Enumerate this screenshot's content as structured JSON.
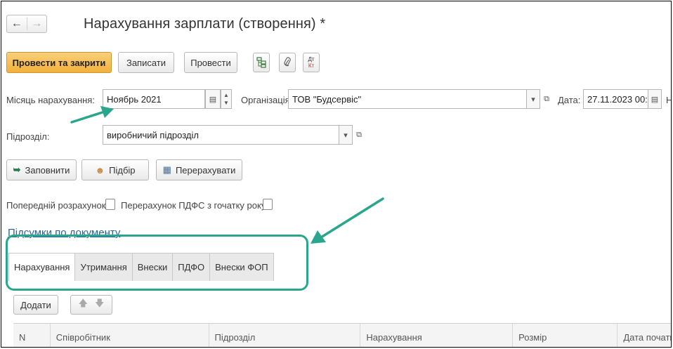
{
  "header": {
    "back_icon": "arrow-left-icon",
    "forward_icon": "arrow-right-icon",
    "title": "Нарахування зарплати (створення) *"
  },
  "toolbar": {
    "post_close": "Провести та закрити",
    "save": "Записати",
    "post": "Провести",
    "structure_icon": "structure-icon",
    "attach_icon": "paperclip-icon",
    "dtkt_icon": "dt-kt-icon",
    "dt": "Дт",
    "kt": "Кт"
  },
  "form": {
    "month_label": "Місяць нарахування:",
    "month_value": "Ноябрь 2021",
    "org_label": "Організація:",
    "org_value": "ТОВ \"Будсервіс\"",
    "date_label": "Дата:",
    "date_value": "27.11.2023 00:0",
    "cut_label": "Н",
    "dept_label": "Підрозділ:",
    "dept_value": "виробничий підрозділ"
  },
  "actions": {
    "fill": "Заповнити",
    "select": "Підбір",
    "recalc": "Перерахувати"
  },
  "options": {
    "prelim": "Попередній розрахунок:",
    "recalc_pdfo": "Перерахунок ПДФС з гочатку року:"
  },
  "totals_link": "Підсумки по документу",
  "tabs": [
    "Нарахування",
    "Утримання",
    "Внески",
    "ПДФО",
    "Внески ФОП"
  ],
  "table_toolbar": {
    "add": "Додати"
  },
  "table": {
    "columns": [
      "N",
      "Співробітник",
      "Підрозділ",
      "Нарахування",
      "Розмір",
      "Дата початк"
    ]
  },
  "colors": {
    "accent": "#f2b03c",
    "annotation": "#2aa58e",
    "link": "#2a6496"
  }
}
